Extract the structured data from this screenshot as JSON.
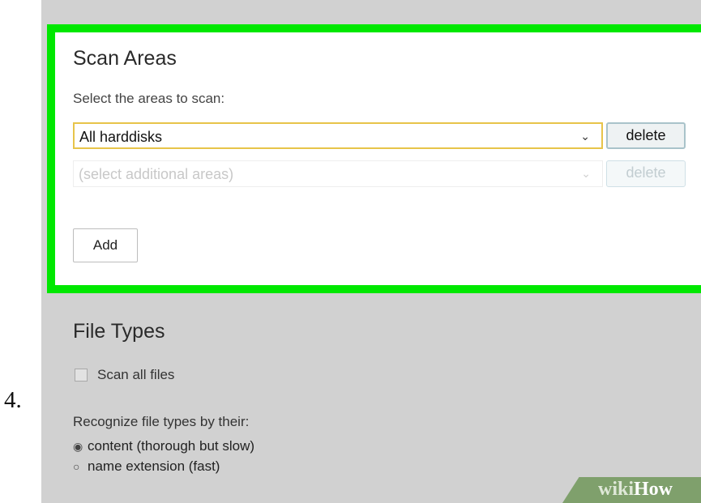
{
  "step_number": "4.",
  "scan_areas": {
    "title": "Scan Areas",
    "subtitle": "Select the areas to scan:",
    "rows": [
      {
        "selected_value": "All harddisks",
        "delete_label": "delete",
        "enabled": true
      },
      {
        "placeholder": "(select additional areas)",
        "delete_label": "delete",
        "enabled": false
      }
    ],
    "add_label": "Add",
    "highlight_color": "#00e800"
  },
  "file_types": {
    "title": "File Types",
    "scan_all_label": "Scan all files",
    "scan_all_checked": false,
    "recognize_label": "Recognize file types by their:",
    "options": [
      {
        "label": "content (thorough but slow)",
        "selected": true
      },
      {
        "label": "name extension (fast)",
        "selected": false
      }
    ]
  },
  "watermark": {
    "part1": "wiki",
    "part2": "How"
  },
  "icons": {
    "dropdown": "chevron-down-icon",
    "radio_on": "radio-selected-icon",
    "radio_off": "radio-unselected-icon",
    "radio_on_glyph": "◉",
    "radio_off_glyph": "○",
    "chevron_glyph": "⌄"
  }
}
